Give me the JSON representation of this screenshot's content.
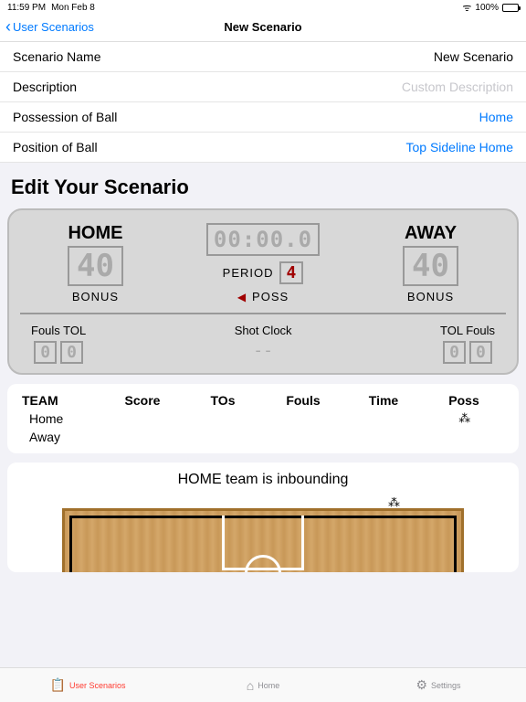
{
  "status": {
    "time": "11:59 PM",
    "date": "Mon Feb 8",
    "battery": "100%"
  },
  "nav": {
    "back": "User Scenarios",
    "title": "New Scenario"
  },
  "form": {
    "rows": [
      {
        "label": "Scenario Name",
        "value": "New Scenario",
        "style": ""
      },
      {
        "label": "Description",
        "value": "Custom Description",
        "style": "placeholder"
      },
      {
        "label": "Possession of Ball",
        "value": "Home",
        "style": "link"
      },
      {
        "label": "Position of Ball",
        "value": "Top Sideline Home",
        "style": "link"
      }
    ]
  },
  "section_title": "Edit Your Scenario",
  "scoreboard": {
    "home_label": "HOME",
    "away_label": "AWAY",
    "home_score": "40",
    "away_score": "40",
    "bonus_label": "BONUS",
    "clock": "00:00.0",
    "period_label": "PERIOD",
    "period": "4",
    "poss_label": "POSS",
    "fouls_tol_label": "Fouls TOL",
    "tol_fouls_label": "TOL Fouls",
    "shot_clock_label": "Shot Clock",
    "shot_clock_value": "--",
    "home_fouls": "0",
    "home_tol": "0",
    "away_tol": "0",
    "away_fouls": "0"
  },
  "stats": {
    "headers": [
      "TEAM",
      "Score",
      "TOs",
      "Fouls",
      "Time",
      "Poss"
    ],
    "rows": [
      {
        "name": "Home",
        "poss": "⁂"
      },
      {
        "name": "Away",
        "poss": ""
      }
    ]
  },
  "court": {
    "title": "HOME team is inbounding"
  },
  "tabs": [
    {
      "label": "User Scenarios",
      "icon": "clipboard",
      "active": true
    },
    {
      "label": "Home",
      "icon": "home",
      "active": false
    },
    {
      "label": "Settings",
      "icon": "sliders",
      "active": false
    }
  ]
}
